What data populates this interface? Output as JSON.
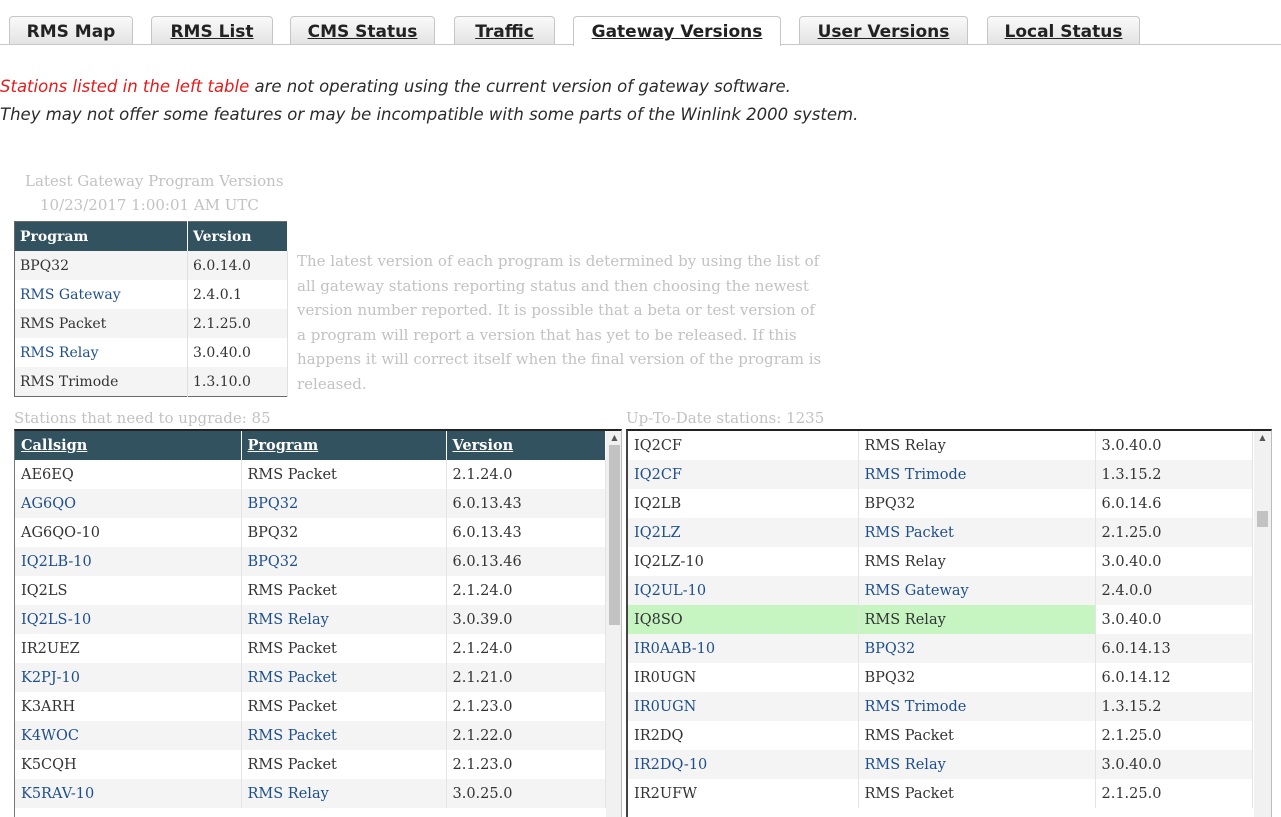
{
  "tabs": [
    {
      "label": "RMS Map"
    },
    {
      "label": "RMS List"
    },
    {
      "label": "CMS Status"
    },
    {
      "label": "Traffic"
    },
    {
      "label": "Gateway Versions",
      "active": true
    },
    {
      "label": "User Versions"
    },
    {
      "label": "Local Status"
    }
  ],
  "notice": {
    "highlight": "Stations listed in the left table",
    "line1_rest": " are not operating using the current version of gateway software.",
    "line2": "They may not offer some features or may be incompatible with some parts of the Winlink 2000 system."
  },
  "latest": {
    "title": "Latest Gateway Program Versions",
    "timestamp": "10/23/2017 1:00:01 AM UTC",
    "headers": [
      "Program",
      "Version"
    ],
    "rows": [
      [
        "BPQ32",
        "6.0.14.0"
      ],
      [
        "RMS Gateway",
        "2.4.0.1"
      ],
      [
        "RMS Packet",
        "2.1.25.0"
      ],
      [
        "RMS Relay",
        "3.0.40.0"
      ],
      [
        "RMS Trimode",
        "1.3.10.0"
      ]
    ]
  },
  "explanation": "The latest version of each program is determined by using the list of all gateway stations reporting status and then choosing the newest version number reported. It is possible that a beta or test version of a program will report a version that has yet to be released. If this happens it will correct itself when the final version of the program is released.",
  "upgrade": {
    "label": "Stations that need to upgrade: 85",
    "headers": [
      "Callsign",
      "Program",
      "Version"
    ],
    "rows": [
      [
        "AE6EQ",
        "RMS Packet",
        "2.1.24.0"
      ],
      [
        "AG6QO",
        "BPQ32",
        "6.0.13.43"
      ],
      [
        "AG6QO-10",
        "BPQ32",
        "6.0.13.43"
      ],
      [
        "IQ2LB-10",
        "BPQ32",
        "6.0.13.46"
      ],
      [
        "IQ2LS",
        "RMS Packet",
        "2.1.24.0"
      ],
      [
        "IQ2LS-10",
        "RMS Relay",
        "3.0.39.0"
      ],
      [
        "IR2UEZ",
        "RMS Packet",
        "2.1.24.0"
      ],
      [
        "K2PJ-10",
        "RMS Packet",
        "2.1.21.0"
      ],
      [
        "K3ARH",
        "RMS Packet",
        "2.1.23.0"
      ],
      [
        "K4WOC",
        "RMS Packet",
        "2.1.22.0"
      ],
      [
        "K5CQH",
        "RMS Packet",
        "2.1.23.0"
      ],
      [
        "K5RAV-10",
        "RMS Relay",
        "3.0.25.0"
      ]
    ]
  },
  "uptodate": {
    "label": "Up-To-Date stations: 1235",
    "rows": [
      [
        "IQ2CF",
        "RMS Relay",
        "3.0.40.0"
      ],
      [
        "IQ2CF",
        "RMS Trimode",
        "1.3.15.2"
      ],
      [
        "IQ2LB",
        "BPQ32",
        "6.0.14.6"
      ],
      [
        "IQ2LZ",
        "RMS Packet",
        "2.1.25.0"
      ],
      [
        "IQ2LZ-10",
        "RMS Relay",
        "3.0.40.0"
      ],
      [
        "IQ2UL-10",
        "RMS Gateway",
        "2.4.0.0"
      ],
      [
        "IQ8SO",
        "RMS Relay",
        "3.0.40.0"
      ],
      [
        "IR0AAB-10",
        "BPQ32",
        "6.0.14.13"
      ],
      [
        "IR0UGN",
        "BPQ32",
        "6.0.14.12"
      ],
      [
        "IR0UGN",
        "RMS Trimode",
        "1.3.15.2"
      ],
      [
        "IR2DQ",
        "RMS Packet",
        "2.1.25.0"
      ],
      [
        "IR2DQ-10",
        "RMS Relay",
        "3.0.40.0"
      ],
      [
        "IR2UFW",
        "RMS Packet",
        "2.1.25.0"
      ]
    ]
  },
  "colors": {
    "header_bg": "#33525f",
    "link": "#1f4f8b",
    "highlight_row": "#c6f5c2",
    "notice_red": "#e51a1a"
  }
}
